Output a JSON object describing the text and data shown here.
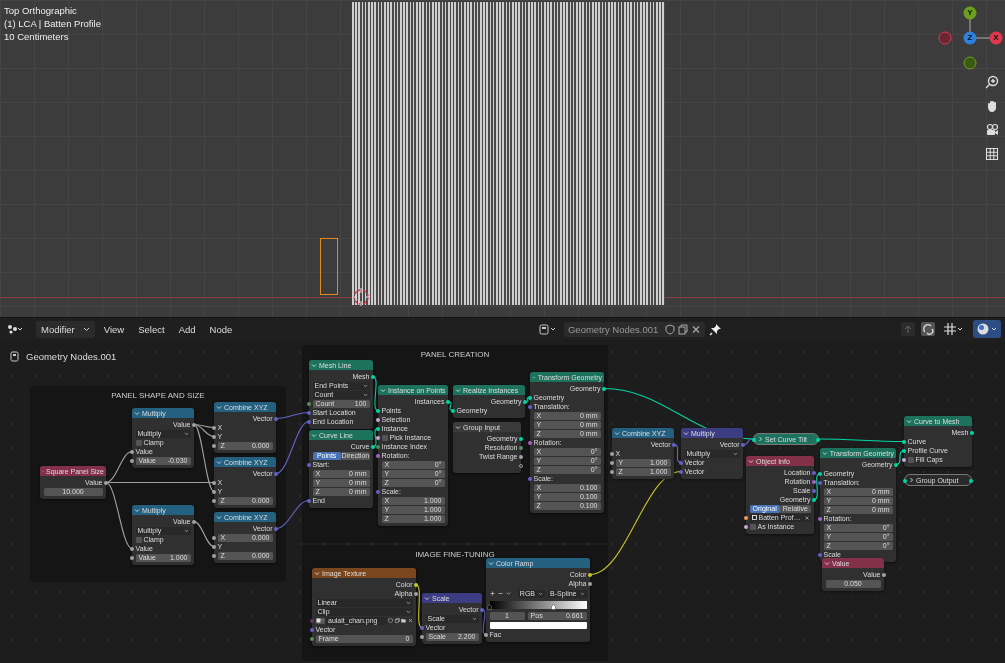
{
  "viewport": {
    "overlay": [
      "Top Orthographic",
      "(1) LCA | Batten Profile",
      "10 Centimeters"
    ],
    "gizmo": [
      {
        "label": "Y",
        "color": "#6ba01e"
      },
      {
        "label": "Z",
        "color": "#2f7fe0"
      },
      {
        "label": "X",
        "color": "#e0384e"
      }
    ]
  },
  "header": {
    "editor_mode": "Modifier",
    "menus": [
      "View",
      "Select",
      "Add",
      "Node"
    ],
    "node_group": "Geometry Nodes.001"
  },
  "breadcrumb": "Geometry Nodes.001",
  "editor": {
    "frames": [
      {
        "title": "PANEL SHAPE AND SIZE"
      },
      {
        "title": "PANEL CREATION"
      },
      {
        "title": "IMAGE FINE-TUNING"
      }
    ],
    "nodes": [
      {
        "title": "Square Panel Size",
        "kind": "input",
        "collapsed": false,
        "rows": [
          {
            "kind": "output",
            "label": "Value",
            "color": "#a1a1a1"
          },
          {
            "kind": "field",
            "value": "10.000"
          }
        ]
      },
      {
        "title": "Multiply",
        "kind": "math",
        "collapsed": false,
        "rows": [
          {
            "kind": "output",
            "label": "Value",
            "color": "#a1a1a1"
          },
          {
            "kind": "dropdown",
            "value": "Multiply"
          },
          {
            "kind": "checkbox",
            "label": "Clamp",
            "checked": false
          },
          {
            "kind": "input",
            "label": "Value",
            "color": "#a1a1a1"
          },
          {
            "kind": "field",
            "label": "Value",
            "value": "-0.030",
            "color": "#a1a1a1"
          }
        ]
      },
      {
        "title": "Multiply",
        "kind": "math",
        "collapsed": false,
        "rows": [
          {
            "kind": "output",
            "label": "Value",
            "color": "#a1a1a1"
          },
          {
            "kind": "dropdown",
            "value": "Multiply"
          },
          {
            "kind": "checkbox",
            "label": "Clamp",
            "checked": false
          },
          {
            "kind": "input",
            "label": "Value",
            "color": "#a1a1a1"
          },
          {
            "kind": "field",
            "label": "Value",
            "value": "1.000",
            "color": "#a1a1a1"
          }
        ]
      },
      {
        "title": "Combine XYZ",
        "kind": "math",
        "collapsed": false,
        "rows": [
          {
            "kind": "output",
            "label": "Vector",
            "color": "#6363c7"
          },
          {
            "kind": "input",
            "label": "X",
            "color": "#a1a1a1"
          },
          {
            "kind": "input",
            "label": "Y",
            "color": "#a1a1a1"
          },
          {
            "kind": "field",
            "label": "Z",
            "value": "0.000",
            "color": "#a1a1a1"
          }
        ]
      },
      {
        "title": "Combine XYZ",
        "kind": "math",
        "collapsed": false,
        "rows": [
          {
            "kind": "output",
            "label": "Vector",
            "color": "#6363c7"
          },
          {
            "kind": "input",
            "label": "X",
            "color": "#a1a1a1"
          },
          {
            "kind": "input",
            "label": "Y",
            "color": "#a1a1a1"
          },
          {
            "kind": "field",
            "label": "Z",
            "value": "0.000",
            "color": "#a1a1a1"
          }
        ]
      },
      {
        "title": "Combine XYZ",
        "kind": "math",
        "collapsed": false,
        "rows": [
          {
            "kind": "output",
            "label": "Vector",
            "color": "#6363c7"
          },
          {
            "kind": "field",
            "label": "X",
            "value": "0.000",
            "color": "#a1a1a1"
          },
          {
            "kind": "input",
            "label": "Y",
            "color": "#a1a1a1"
          },
          {
            "kind": "field",
            "label": "Z",
            "value": "0.000",
            "color": "#a1a1a1"
          }
        ]
      },
      {
        "title": "Mesh Line",
        "kind": "geometry",
        "collapsed": false,
        "rows": [
          {
            "kind": "output",
            "label": "Mesh",
            "color": "#00d6a3"
          },
          {
            "kind": "dropdown",
            "value": "End Points"
          },
          {
            "kind": "dropdown",
            "value": "Count"
          },
          {
            "kind": "field",
            "label": "Count",
            "value": "100",
            "color": "#598c5c"
          },
          {
            "kind": "input",
            "label": "Start Location",
            "color": "#6363c7"
          },
          {
            "kind": "input",
            "label": "End Location",
            "color": "#6363c7"
          }
        ]
      },
      {
        "title": "Curve Line",
        "kind": "geometry",
        "collapsed": false,
        "rows": [
          {
            "kind": "output",
            "label": "Curve",
            "color": "#00d6a3"
          },
          {
            "kind": "toggle",
            "options": [
              {
                "label": "Points",
                "selected": true
              },
              {
                "label": "Direction",
                "selected": false
              }
            ]
          },
          {
            "kind": "input",
            "label": "Start:",
            "color": "#6363c7"
          },
          {
            "kind": "field",
            "label": "X",
            "value": "0 mm"
          },
          {
            "kind": "field",
            "label": "Y",
            "value": "0 mm"
          },
          {
            "kind": "field",
            "label": "Z",
            "value": "0 mm"
          },
          {
            "kind": "input",
            "label": "End",
            "color": "#6363c7"
          }
        ]
      },
      {
        "title": "Instance on Points",
        "kind": "geometry",
        "collapsed": false,
        "rows": [
          {
            "kind": "output",
            "label": "Instances",
            "color": "#00d6a3"
          },
          {
            "kind": "input",
            "label": "Points",
            "color": "#00d6a3"
          },
          {
            "kind": "input",
            "label": "Selection",
            "color": "#cca6d6"
          },
          {
            "kind": "input",
            "label": "Instance",
            "color": "#00d6a3"
          },
          {
            "kind": "checkbox",
            "label": "Pick Instance",
            "checked": false,
            "color": "#cca6d6"
          },
          {
            "kind": "input",
            "label": "Instance Index",
            "color": "#598c5c"
          },
          {
            "kind": "input",
            "label": "Rotation:",
            "color": "#a663c7"
          },
          {
            "kind": "field",
            "label": "X",
            "value": "0°"
          },
          {
            "kind": "field",
            "label": "Y",
            "value": "0°"
          },
          {
            "kind": "field",
            "label": "Z",
            "value": "0°"
          },
          {
            "kind": "input",
            "label": "Scale:",
            "color": "#6363c7"
          },
          {
            "kind": "field",
            "label": "X",
            "value": "1.000"
          },
          {
            "kind": "field",
            "label": "Y",
            "value": "1.000"
          },
          {
            "kind": "field",
            "label": "Z",
            "value": "1.000"
          }
        ]
      },
      {
        "title": "Realize Instances",
        "kind": "geometry",
        "collapsed": false,
        "rows": [
          {
            "kind": "output",
            "label": "Geometry",
            "color": "#00d6a3"
          },
          {
            "kind": "input",
            "label": "Geometry",
            "color": "#00d6a3"
          }
        ]
      },
      {
        "title": "Group Input",
        "kind": "group",
        "collapsed": false,
        "rows": [
          {
            "kind": "output",
            "label": "Geometry",
            "color": "#00d6a3"
          },
          {
            "kind": "output",
            "label": "Resolution",
            "color": "#598c5c"
          },
          {
            "kind": "output",
            "label": "Twist Range",
            "color": "#a1a1a1"
          },
          {
            "kind": "empty-socket"
          }
        ]
      },
      {
        "title": "Transform Geometry",
        "kind": "geometry",
        "collapsed": false,
        "rows": [
          {
            "kind": "output",
            "label": "Geometry",
            "color": "#00d6a3"
          },
          {
            "kind": "input",
            "label": "Geometry",
            "color": "#00d6a3"
          },
          {
            "kind": "input",
            "label": "Translation:",
            "color": "#6363c7"
          },
          {
            "kind": "field",
            "label": "X",
            "value": "0 mm"
          },
          {
            "kind": "field",
            "label": "Y",
            "value": "0 mm"
          },
          {
            "kind": "field",
            "label": "Z",
            "value": "0 mm"
          },
          {
            "kind": "input",
            "label": "Rotation:",
            "color": "#a663c7"
          },
          {
            "kind": "field",
            "label": "X",
            "value": "0°"
          },
          {
            "kind": "field",
            "label": "Y",
            "value": "0°"
          },
          {
            "kind": "field",
            "label": "Z",
            "value": "0°"
          },
          {
            "kind": "input",
            "label": "Scale:",
            "color": "#6363c7"
          },
          {
            "kind": "field",
            "label": "X",
            "value": "0.100"
          },
          {
            "kind": "field",
            "label": "Y",
            "value": "0.100"
          },
          {
            "kind": "field",
            "label": "Z",
            "value": "0.100"
          }
        ]
      },
      {
        "title": "Combine XYZ",
        "kind": "math",
        "collapsed": false,
        "rows": [
          {
            "kind": "output",
            "label": "Vector",
            "color": "#6363c7"
          },
          {
            "kind": "input",
            "label": "X",
            "color": "#a1a1a1"
          },
          {
            "kind": "field",
            "label": "Y",
            "value": "1.000",
            "color": "#a1a1a1"
          },
          {
            "kind": "field",
            "label": "Z",
            "value": "1.000",
            "color": "#a1a1a1"
          }
        ]
      },
      {
        "title": "Multiply",
        "kind": "vector",
        "collapsed": false,
        "rows": [
          {
            "kind": "output",
            "label": "Vector",
            "color": "#6363c7"
          },
          {
            "kind": "dropdown",
            "value": "Multiply"
          },
          {
            "kind": "input",
            "label": "Vector",
            "color": "#6363c7"
          },
          {
            "kind": "input",
            "label": "Vector",
            "color": "#6363c7"
          }
        ]
      },
      {
        "title": "Set Curve Tilt",
        "kind": "geometry",
        "collapsed": true
      },
      {
        "title": "Object Info",
        "kind": "input",
        "collapsed": false,
        "rows": [
          {
            "kind": "output",
            "label": "Location",
            "color": "#6363c7"
          },
          {
            "kind": "output",
            "label": "Rotation",
            "color": "#a663c7"
          },
          {
            "kind": "output",
            "label": "Scale",
            "color": "#6363c7"
          },
          {
            "kind": "output",
            "label": "Geometry",
            "color": "#00d6a3"
          },
          {
            "kind": "toggle",
            "options": [
              {
                "label": "Original",
                "selected": true
              },
              {
                "label": "Relative",
                "selected": false
              }
            ]
          },
          {
            "kind": "object",
            "value": "Batten Prof…",
            "color": "#ed9e5c"
          },
          {
            "kind": "checkbox",
            "label": "As Instance",
            "checked": false,
            "color": "#cca6d6"
          }
        ]
      },
      {
        "title": "Transform Geometry",
        "kind": "geometry",
        "collapsed": false,
        "rows": [
          {
            "kind": "output",
            "label": "Geometry",
            "color": "#00d6a3"
          },
          {
            "kind": "input",
            "label": "Geometry",
            "color": "#00d6a3"
          },
          {
            "kind": "input",
            "label": "Translation:",
            "color": "#6363c7"
          },
          {
            "kind": "field",
            "label": "X",
            "value": "0 mm"
          },
          {
            "kind": "field",
            "label": "Y",
            "value": "0 mm"
          },
          {
            "kind": "field",
            "label": "Z",
            "value": "0 mm"
          },
          {
            "kind": "input",
            "label": "Rotation:",
            "color": "#a663c7"
          },
          {
            "kind": "field",
            "label": "X",
            "value": "0°"
          },
          {
            "kind": "field",
            "label": "Y",
            "value": "0°"
          },
          {
            "kind": "field",
            "label": "Z",
            "value": "0°"
          },
          {
            "kind": "input",
            "label": "Scale",
            "color": "#6363c7"
          }
        ]
      },
      {
        "title": "Value",
        "kind": "input",
        "collapsed": false,
        "rows": [
          {
            "kind": "output",
            "label": "Value",
            "color": "#a1a1a1"
          },
          {
            "kind": "field",
            "value": "0.050"
          }
        ]
      },
      {
        "title": "Curve to Mesh",
        "kind": "geometry",
        "collapsed": false,
        "rows": [
          {
            "kind": "output",
            "label": "Mesh",
            "color": "#00d6a3"
          },
          {
            "kind": "input",
            "label": "Curve",
            "color": "#00d6a3"
          },
          {
            "kind": "input",
            "label": "Profile Curve",
            "color": "#00d6a3"
          },
          {
            "kind": "checkbox",
            "label": "Fill Caps",
            "checked": false,
            "color": "#cca6d6"
          }
        ]
      },
      {
        "title": "Group Output",
        "kind": "output",
        "collapsed": true
      },
      {
        "title": "Image Texture",
        "kind": "texture",
        "collapsed": false,
        "rows": [
          {
            "kind": "output",
            "label": "Color",
            "color": "#c7c729"
          },
          {
            "kind": "output",
            "label": "Alpha",
            "color": "#a1a1a1"
          },
          {
            "kind": "dropdown",
            "value": "Linear"
          },
          {
            "kind": "dropdown",
            "value": "Clip"
          },
          {
            "kind": "image",
            "value": "aulait_chan.png",
            "color": "#633863"
          },
          {
            "kind": "input",
            "label": "Vector",
            "color": "#6363c7"
          },
          {
            "kind": "field",
            "label": "Frame",
            "value": "0",
            "color": "#598c5c"
          }
        ]
      },
      {
        "title": "Scale",
        "kind": "vector",
        "collapsed": false,
        "rows": [
          {
            "kind": "output",
            "label": "Vector",
            "color": "#6363c7"
          },
          {
            "kind": "dropdown",
            "value": "Scale"
          },
          {
            "kind": "input",
            "label": "Vector",
            "color": "#6363c7"
          },
          {
            "kind": "field",
            "label": "Scale",
            "value": "2.200",
            "color": "#a1a1a1"
          }
        ]
      },
      {
        "title": "Color Ramp",
        "kind": "math",
        "collapsed": false,
        "rows": [
          {
            "kind": "output",
            "label": "Color",
            "color": "#c7c729"
          },
          {
            "kind": "output",
            "label": "Alpha",
            "color": "#a1a1a1"
          },
          {
            "kind": "ramp-tools",
            "mode": "RGB",
            "interpolation": "B-Spline"
          },
          {
            "kind": "ramp",
            "level": 0.661
          },
          {
            "kind": "stop",
            "index": "1",
            "label": "Pos",
            "value": "0.661"
          },
          {
            "kind": "swatch",
            "color": "#ffffff"
          },
          {
            "kind": "input",
            "label": "Fac",
            "color": "#a1a1a1"
          }
        ]
      }
    ]
  }
}
